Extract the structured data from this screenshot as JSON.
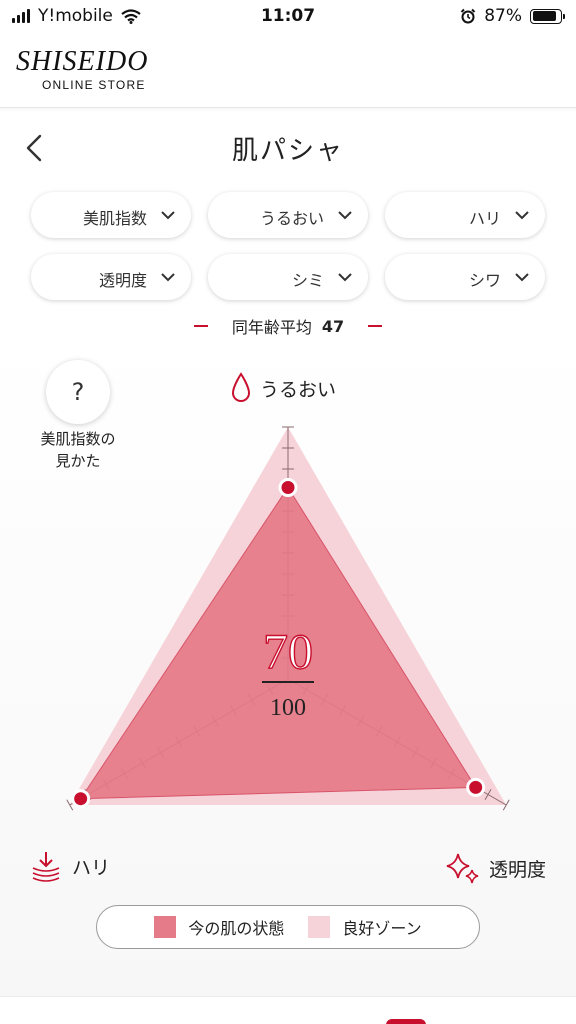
{
  "status_bar": {
    "carrier": "Y!mobile",
    "time": "11:07",
    "battery": "87%",
    "battery_level": 0.87,
    "icons": [
      "signal-icon",
      "wifi-icon",
      "alarm-icon",
      "battery-icon"
    ]
  },
  "header": {
    "logo_main": "SHISEIDO",
    "logo_sub": "ONLINE STORE"
  },
  "page": {
    "title": "肌パシャ",
    "back_icon": "chevron-left-icon"
  },
  "filters": [
    {
      "label": "美肌指数"
    },
    {
      "label": "うるおい"
    },
    {
      "label": "ハリ"
    },
    {
      "label": "透明度"
    },
    {
      "label": "シミ"
    },
    {
      "label": "シワ"
    }
  ],
  "average": {
    "label": "同年齢平均",
    "value": "47"
  },
  "help": {
    "symbol": "?",
    "label_line1": "美肌指数の",
    "label_line2": "見かた"
  },
  "axes": {
    "top": {
      "label": "うるおい",
      "icon": "water-drop-icon"
    },
    "left": {
      "label": "ハリ",
      "icon": "firmness-arrow-icon"
    },
    "right": {
      "label": "透明度",
      "icon": "sparkle-icon"
    }
  },
  "chart_data": {
    "type": "radar",
    "axes": [
      "うるおい",
      "透明度",
      "ハリ"
    ],
    "series": [
      {
        "name": "今の肌の状態",
        "values": [
          0.76,
          0.86,
          0.95
        ],
        "color": "#e57a88"
      },
      {
        "name": "良好ゾーン",
        "values": [
          1.0,
          1.0,
          1.0
        ],
        "color": "#f6d3d8"
      }
    ],
    "score": "70",
    "score_max": "100",
    "accent": "#c8102e"
  },
  "legend": {
    "current_label": "今の肌の状態",
    "good_label": "良好ゾーン"
  }
}
